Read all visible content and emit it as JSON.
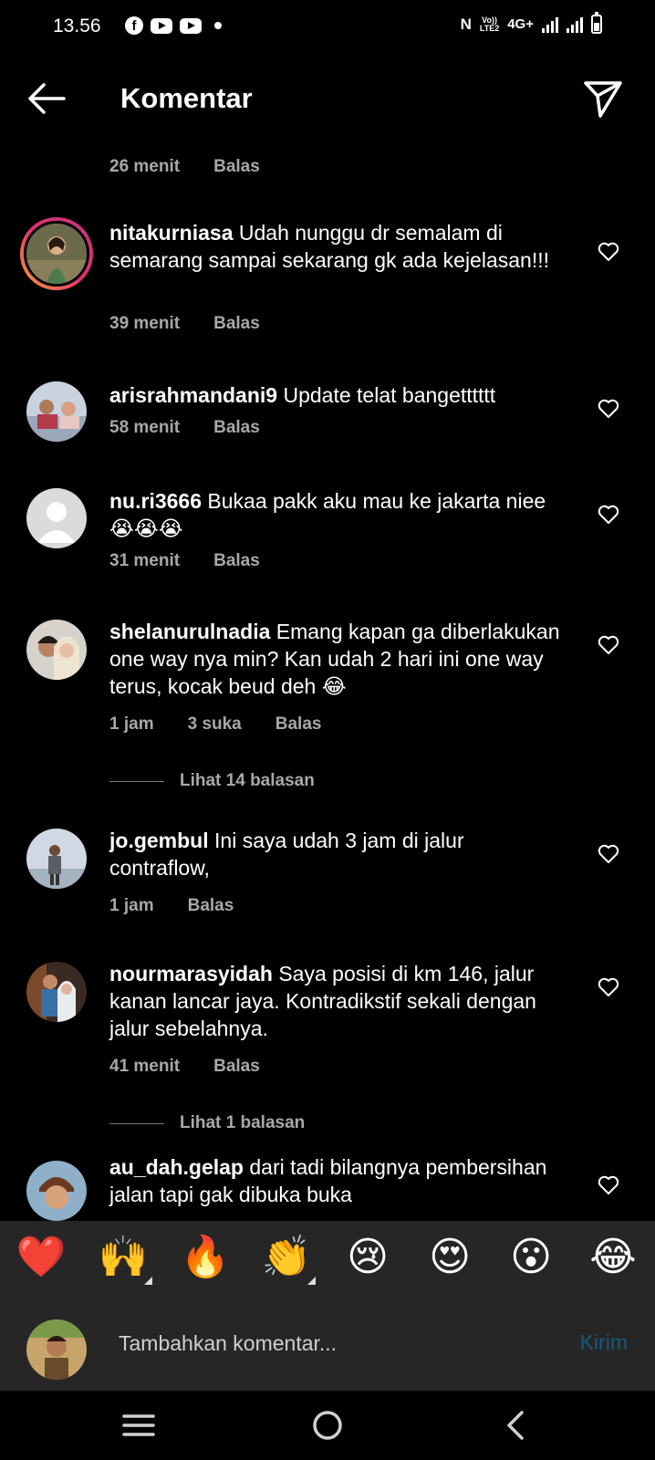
{
  "status_bar": {
    "time": "13.56",
    "volte_top": "Vo))",
    "volte_bottom": "LTE2",
    "network": "4G+"
  },
  "header": {
    "title": "Komentar"
  },
  "partial_top": {
    "time": "26 menit",
    "reply": "Balas"
  },
  "comments": [
    {
      "username": "nitakurniasa",
      "text": "Udah nunggu dr semalam di semarang sampai sekarang gk ada kejelasan!!!",
      "time": "39 menit",
      "reply": "Balas"
    },
    {
      "username": "arisrahmandani9",
      "text": "Update telat bangetttttt",
      "time": "58 menit",
      "reply": "Balas"
    },
    {
      "username": "nu.ri3666",
      "text": "Bukaa pakk aku mau ke jakarta niee😭😭😭",
      "time": "31 menit",
      "reply": "Balas"
    },
    {
      "username": "shelanurulnadia",
      "text": "Emang kapan ga diberlakukan one way nya min? Kan udah 2 hari ini one way terus, kocak beud deh 😂",
      "time": "1 jam",
      "likes": "3 suka",
      "reply": "Balas",
      "view_replies": "Lihat 14 balasan"
    },
    {
      "username": "jo.gembul",
      "text": "Ini saya udah 3 jam di jalur contraflow,",
      "time": "1 jam",
      "reply": "Balas"
    },
    {
      "username": "nourmarasyidah",
      "text": "Saya posisi di km 146, jalur kanan lancar jaya. Kontradikstif sekali dengan jalur sebelahnya.",
      "time": "41 menit",
      "reply": "Balas",
      "view_replies": "Lihat 1 balasan"
    },
    {
      "username": "au_dah.gelap",
      "text": "dari tadi bilangnya pembersihan jalan tapi gak dibuka buka"
    }
  ],
  "emoji_bar": [
    "❤️",
    "🙌",
    "🔥",
    "👏",
    "😢",
    "😍",
    "😮",
    "😂"
  ],
  "input": {
    "placeholder": "Tambahkan komentar...",
    "send_label": "Kirim"
  },
  "colors": {
    "background": "#000000",
    "muted_text": "#a8a8a8",
    "input_bar": "#262626",
    "send_disabled": "#19587a"
  }
}
